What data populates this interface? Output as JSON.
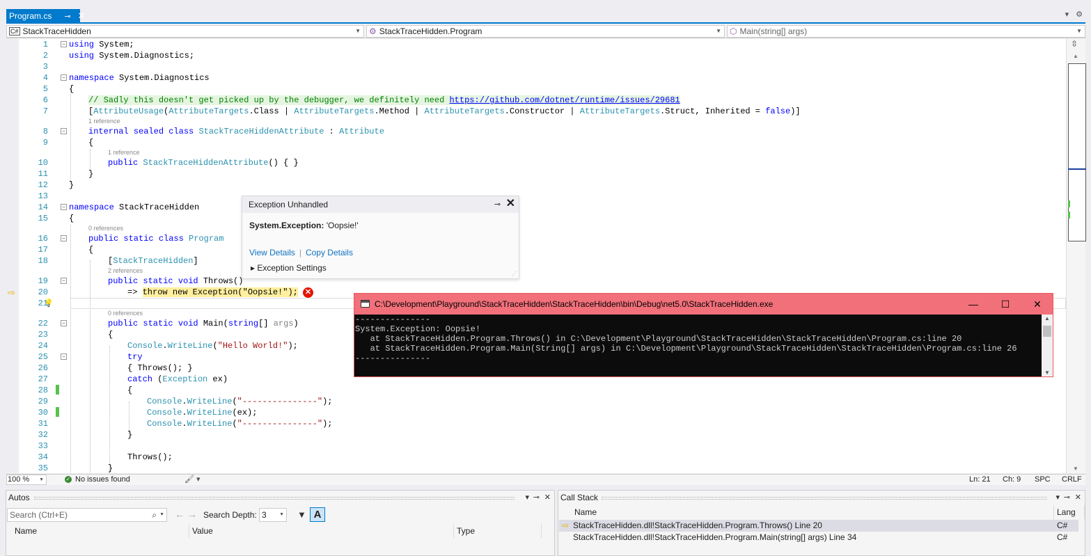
{
  "tab": {
    "title": "Program.cs",
    "pin": "⊸",
    "close": "✕"
  },
  "navbar": {
    "project_badge": "C#",
    "project": "StackTraceHidden",
    "class": "StackTraceHidden.Program",
    "member": "Main(string[] args)"
  },
  "code": {
    "l1": [
      "using",
      " System;"
    ],
    "l2": [
      "using",
      " System.Diagnostics;"
    ],
    "l4": [
      "namespace",
      " System.Diagnostics"
    ],
    "l5": "{",
    "l6": {
      "comment": "// Sadly this doesn't get picked up by the debugger, we definitely need ",
      "url": "https://github.com/dotnet/runtime/issues/29681"
    },
    "l7": [
      "[",
      "AttributeUsage",
      "(",
      "AttributeTargets",
      ".Class | ",
      "AttributeTargets",
      ".Method | ",
      "AttributeTargets",
      ".Constructor | ",
      "AttributeTargets",
      ".Struct, Inherited = ",
      "false",
      ")]"
    ],
    "ref8": "1 reference",
    "l8": [
      "internal sealed class",
      " ",
      "StackTraceHiddenAttribute",
      " : ",
      "Attribute"
    ],
    "l9": "{",
    "ref10": "1 reference",
    "l10": [
      "public",
      " ",
      "StackTraceHiddenAttribute",
      "() { }"
    ],
    "l11": "}",
    "l12": "}",
    "l14": [
      "namespace",
      " StackTraceHidden"
    ],
    "l15": "{",
    "ref16": "0 references",
    "l16": [
      "public static class",
      " ",
      "Program"
    ],
    "l17": "{",
    "l18": [
      "[",
      "StackTraceHidden",
      "]"
    ],
    "ref19": "2 references",
    "l19": [
      "public static void",
      " Throws()"
    ],
    "l20": [
      "=> ",
      "throw new Exception(\"Oopsie!\");"
    ],
    "ref22": "0 references",
    "l22": [
      "public static void",
      " Main(",
      "string",
      "[] ",
      "args",
      ")"
    ],
    "l23": "{",
    "l24": [
      "Console",
      ".",
      "WriteLine",
      "(",
      "\"Hello World!\"",
      ");"
    ],
    "l25": "try",
    "l26": "{ Throws(); }",
    "l27": [
      "catch",
      " (",
      "Exception",
      " ex)"
    ],
    "l28": "{",
    "l29": [
      "Console",
      ".",
      "WriteLine",
      "(",
      "\"---------------\"",
      ");"
    ],
    "l30": [
      "Console",
      ".",
      "WriteLine",
      "(ex);"
    ],
    "l31": [
      "Console",
      ".",
      "WriteLine",
      "(",
      "\"---------------\"",
      ");"
    ],
    "l32": "}",
    "l34": "Throws();",
    "l35": "}",
    "line_numbers": [
      "1",
      "2",
      "3",
      "4",
      "5",
      "6",
      "7",
      "8",
      "9",
      "10",
      "11",
      "12",
      "13",
      "14",
      "15",
      "16",
      "17",
      "18",
      "19",
      "20",
      "21",
      "22",
      "23",
      "24",
      "25",
      "26",
      "27",
      "28",
      "29",
      "30",
      "31",
      "32",
      "33",
      "34",
      "35"
    ]
  },
  "status": {
    "zoom": "100 %",
    "issues": "No issues found",
    "ln": "Ln: 21",
    "ch": "Ch: 9",
    "spc": "SPC",
    "eol": "CRLF"
  },
  "autos": {
    "title": "Autos",
    "search_placeholder": "Search (Ctrl+E)",
    "depth_label": "Search Depth:",
    "depth_value": "3",
    "columns": [
      "Name",
      "Value",
      "Type"
    ]
  },
  "callstack": {
    "title": "Call Stack",
    "columns": [
      "Name",
      "Lang"
    ],
    "rows": [
      {
        "name": "StackTraceHidden.dll!StackTraceHidden.Program.Throws() Line 20",
        "lang": "C#"
      },
      {
        "name": "StackTraceHidden.dll!StackTraceHidden.Program.Main(string[] args) Line 34",
        "lang": "C#"
      }
    ]
  },
  "exception": {
    "title": "Exception Unhandled",
    "type": "System.Exception:",
    "message": " 'Oopsie!'",
    "view_details": "View Details",
    "copy_details": "Copy Details",
    "settings": "Exception Settings"
  },
  "console": {
    "title": "C:\\Development\\Playground\\StackTraceHidden\\StackTraceHidden\\bin\\Debug\\net5.0\\StackTraceHidden.exe",
    "lines": [
      "---------------",
      "System.Exception: Oopsie!",
      "   at StackTraceHidden.Program.Throws() in C:\\Development\\Playground\\StackTraceHidden\\StackTraceHidden\\Program.cs:line 20",
      "   at StackTraceHidden.Program.Main(String[] args) in C:\\Development\\Playground\\StackTraceHidden\\StackTraceHidden\\Program.cs:line 26",
      "---------------"
    ]
  }
}
